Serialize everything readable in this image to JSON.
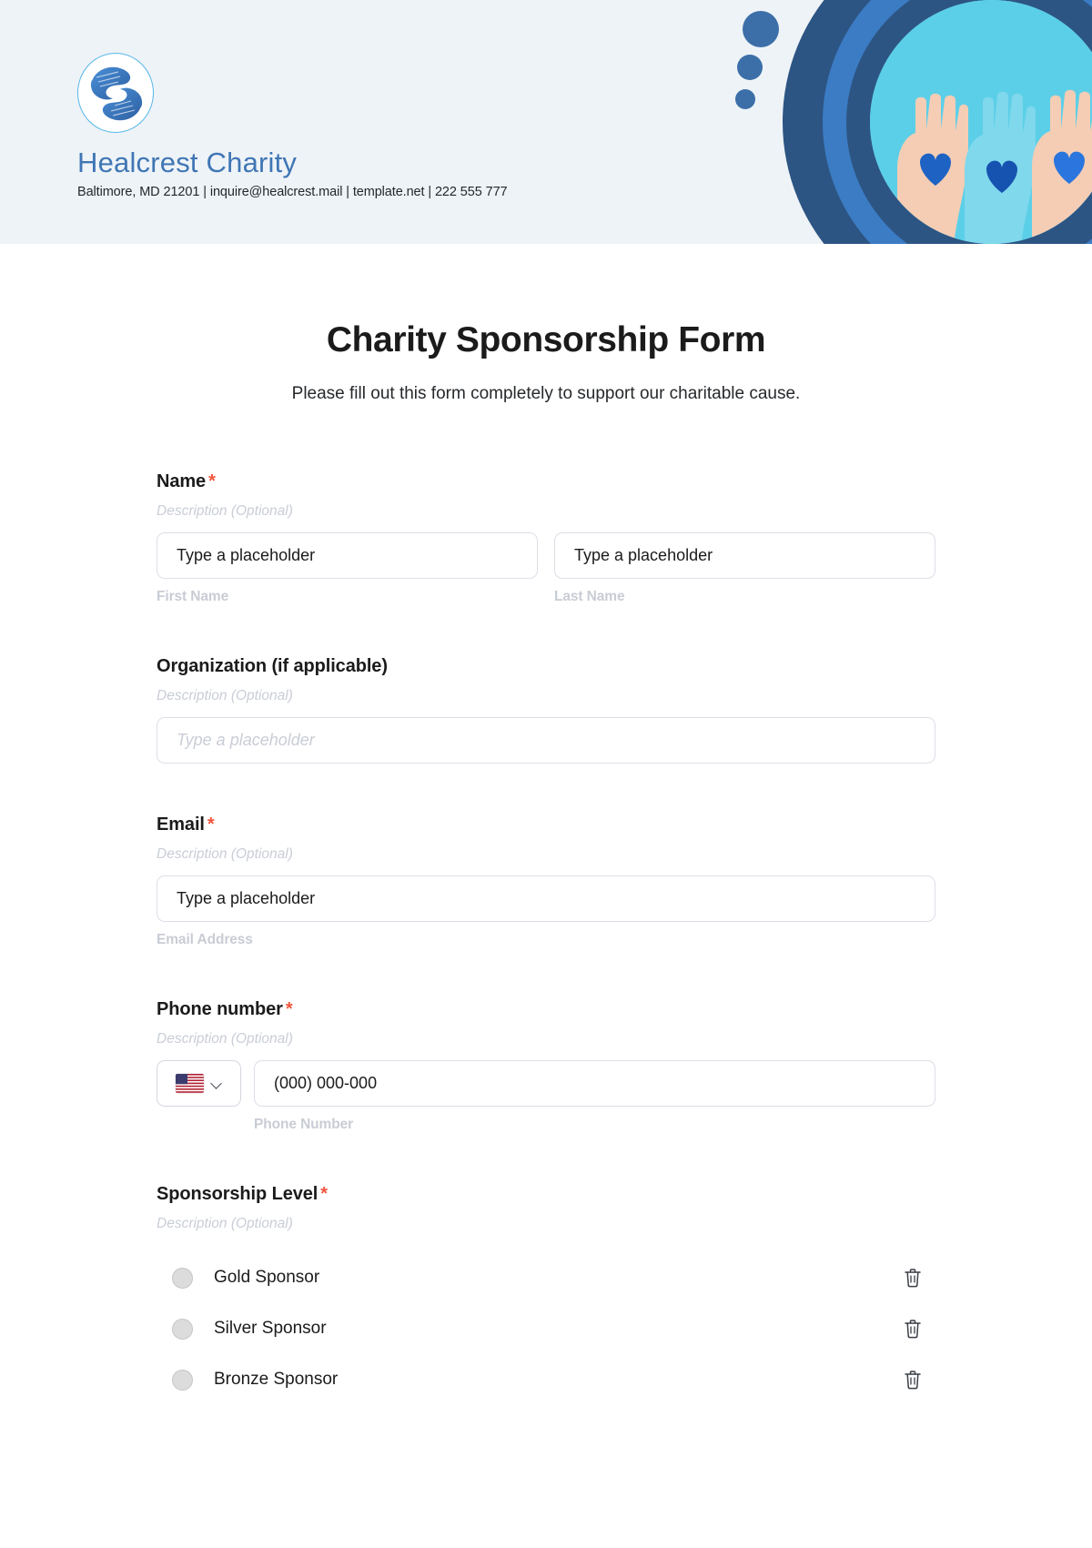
{
  "header": {
    "brand_name": "Healcrest Charity",
    "contact_line": "Baltimore, MD 21201 | inquire@healcrest.mail | template.net | 222 555 777",
    "logo_icon": "helping-hands-logo",
    "art_image_alt": "raised-hands-with-blue-hearts-photo",
    "colors": {
      "band_bg": "#eef3f7",
      "brand_blue": "#3f76b5",
      "ring_dark": "#2d5583",
      "ring_light": "#3b7cc4",
      "photo_bg": "#5ccfe8"
    }
  },
  "form": {
    "title": "Charity Sponsorship Form",
    "subtitle": "Please fill out this form completely to support our charitable cause.",
    "required_marker": "*",
    "description_placeholder": "Description (Optional)",
    "fields": {
      "name": {
        "label": "Name",
        "required": true,
        "description": "Description (Optional)",
        "first": {
          "value": "Type a placeholder",
          "sublabel": "First Name"
        },
        "last": {
          "value": "Type a placeholder",
          "sublabel": "Last Name"
        }
      },
      "organization": {
        "label": "Organization (if applicable)",
        "required": false,
        "description": "Description (Optional)",
        "placeholder": "Type a placeholder"
      },
      "email": {
        "label": "Email",
        "required": true,
        "description": "Description (Optional)",
        "value": "Type a placeholder",
        "sublabel": "Email Address"
      },
      "phone": {
        "label": "Phone number",
        "required": true,
        "description": "Description (Optional)",
        "country_flag": "us-flag",
        "value": "(000) 000-000",
        "sublabel": "Phone Number"
      },
      "sponsorship_level": {
        "label": "Sponsorship Level",
        "required": true,
        "description": "Description (Optional)",
        "options": [
          {
            "label": "Gold Sponsor",
            "selected": false,
            "delete_icon": "trash-icon"
          },
          {
            "label": "Silver Sponsor",
            "selected": false,
            "delete_icon": "trash-icon"
          },
          {
            "label": "Bronze Sponsor",
            "selected": false,
            "delete_icon": "trash-icon"
          }
        ]
      }
    }
  }
}
